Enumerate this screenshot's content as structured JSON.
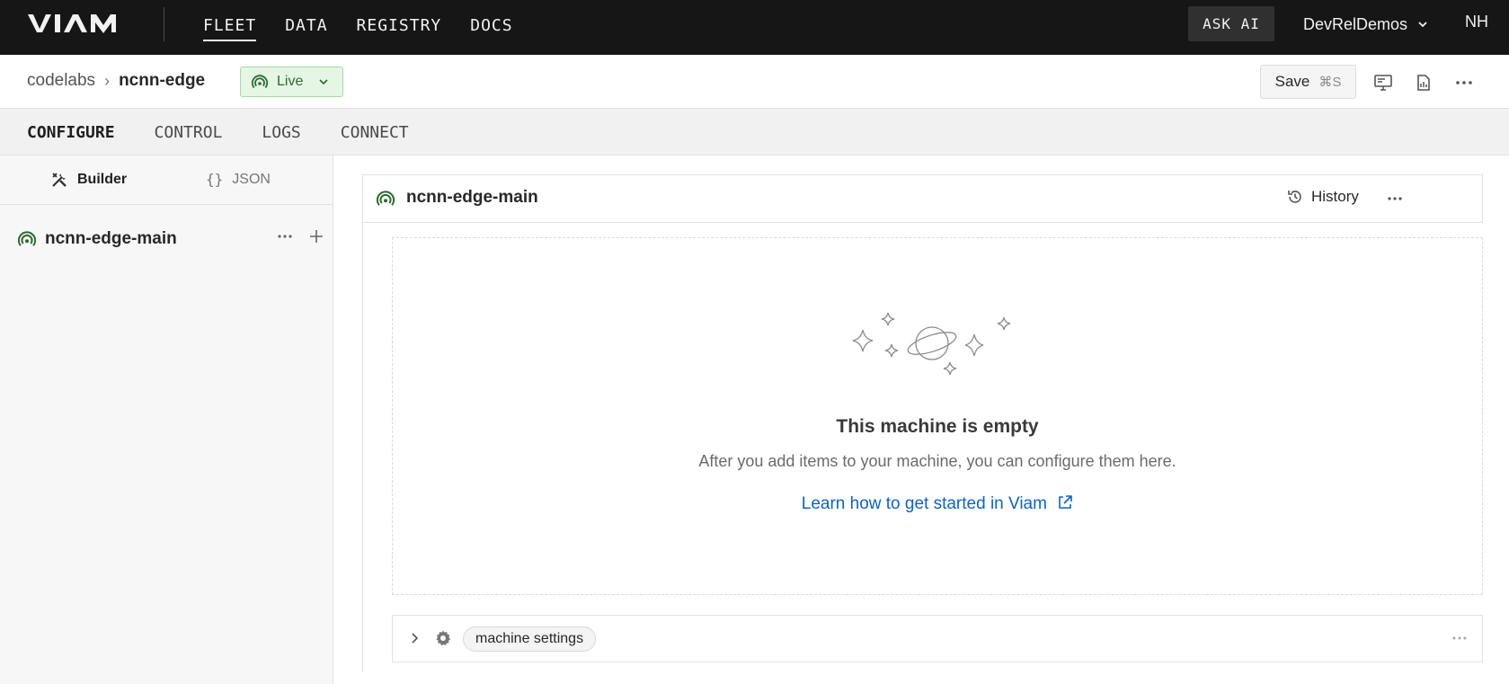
{
  "app": {
    "logo_text": "VIAM"
  },
  "topnav": {
    "links": [
      "FLEET",
      "DATA",
      "REGISTRY",
      "DOCS"
    ],
    "active_link": "FLEET",
    "ask_ai_label": "ASK AI",
    "org_name": "DevRelDemos",
    "user_initials": "NH"
  },
  "breadcrumb": {
    "org": "codelabs",
    "machine": "ncnn-edge",
    "status_label": "Live"
  },
  "header_actions": {
    "save_label": "Save",
    "save_shortcut": "⌘S"
  },
  "tabs": [
    "CONFIGURE",
    "CONTROL",
    "LOGS",
    "CONNECT"
  ],
  "active_tab": "CONFIGURE",
  "sidebar": {
    "modes": [
      {
        "label": "Builder",
        "icon": "tools-icon"
      },
      {
        "label": "JSON",
        "icon": "braces-icon"
      }
    ],
    "active_mode": "Builder",
    "part_name": "ncnn-edge-main"
  },
  "main": {
    "part_name": "ncnn-edge-main",
    "history_label": "History",
    "empty_title": "This machine is empty",
    "empty_description": "After you add items to your machine, you can configure them here.",
    "empty_link": "Learn how to get started in Viam",
    "settings_label": "machine settings"
  },
  "colors": {
    "topnav_bg": "#161616",
    "live_green": "#2c6b2c",
    "link_blue": "#0b63ce"
  }
}
